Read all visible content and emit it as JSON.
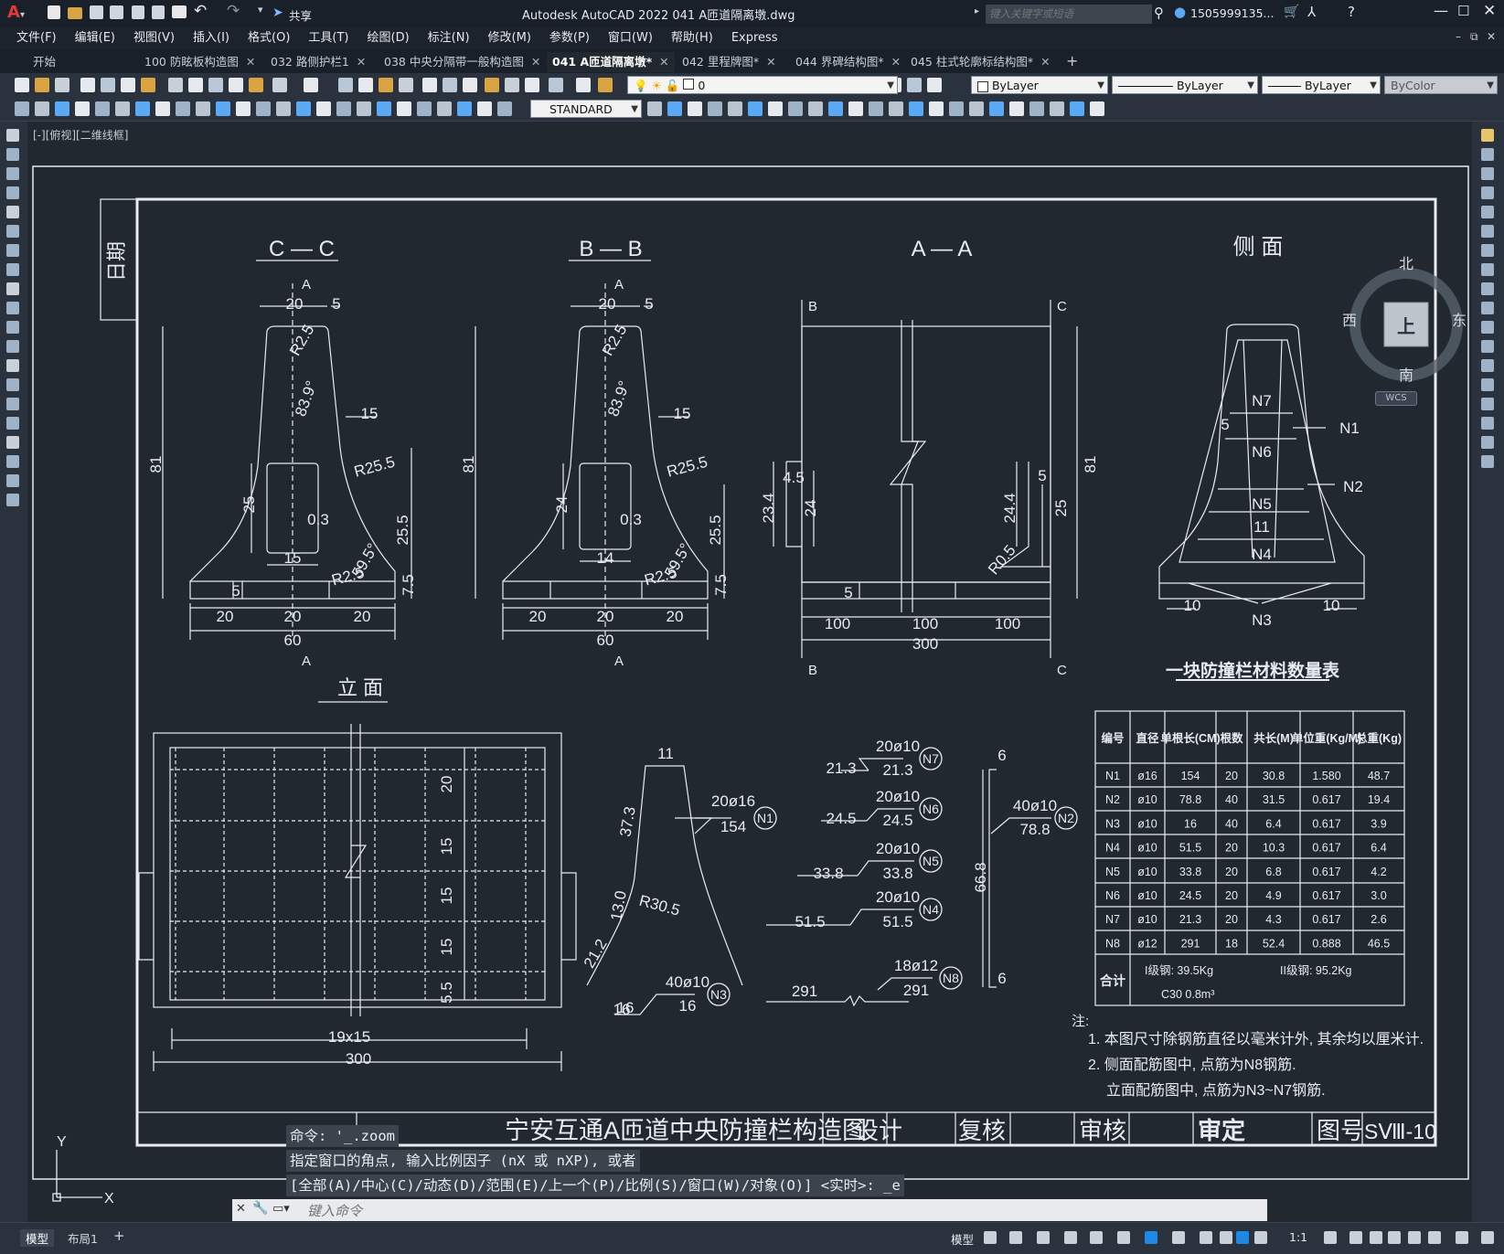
{
  "app": {
    "title": "Autodesk AutoCAD 2022    041 A匝道隔离墩.dwg",
    "share": "共享",
    "search_placeholder": "键入关键字或短语",
    "user": "1505999135...",
    "quick_access": [
      "new-icon",
      "open-icon",
      "save-icon",
      "saveas-icon",
      "plot-icon",
      "undo-icon",
      "redo-icon"
    ]
  },
  "menu": [
    "文件(F)",
    "编辑(E)",
    "视图(V)",
    "插入(I)",
    "格式(O)",
    "工具(T)",
    "绘图(D)",
    "标注(N)",
    "修改(M)",
    "参数(P)",
    "窗口(W)",
    "帮助(H)",
    "Express"
  ],
  "tabs": [
    {
      "label": "开始",
      "active": false,
      "closable": false
    },
    {
      "label": "100 防眩板构造图",
      "active": false,
      "closable": true
    },
    {
      "label": "032 路侧护栏1",
      "active": false,
      "closable": true
    },
    {
      "label": "038 中央分隔带一般构造图",
      "active": false,
      "closable": true
    },
    {
      "label": "041 A匝道隔离墩*",
      "active": true,
      "closable": true
    },
    {
      "label": "042 里程牌图*",
      "active": false,
      "closable": true
    },
    {
      "label": "044 界碑结构图*",
      "active": false,
      "closable": true
    },
    {
      "label": "045 柱式轮廓标结构图*",
      "active": false,
      "closable": true
    }
  ],
  "toolbar": {
    "layer_value": "0",
    "color": "ByLayer",
    "linetype": "ByLayer",
    "lineweight": "ByLayer",
    "plotstyle": "ByColor",
    "textstyle": "STANDARD"
  },
  "viewport_label": "[-][俯视][二维线框]",
  "viewcube": {
    "north": "北",
    "south": "南",
    "east": "东",
    "west": "西",
    "top": "上",
    "wcs": "WCS"
  },
  "drawing": {
    "date_label": "日期",
    "views": {
      "cc": "C — C",
      "bb": "B — B",
      "aa": "A — A",
      "side": "侧 面",
      "elev": "立 面"
    },
    "section_markers": {
      "a": "A",
      "b": "B",
      "c": "C"
    },
    "cc_dims": [
      "20",
      "5",
      "R2.5",
      "83.9°",
      "15",
      "R25.5",
      "81",
      "25",
      "0.3",
      "15",
      "25.5",
      "R2.5",
      "59.5°",
      "7.5",
      "5",
      "20",
      "20",
      "20",
      "60"
    ],
    "bb_dims": [
      "20",
      "5",
      "R2.5",
      "83.9°",
      "15",
      "R25.5",
      "81",
      "24",
      "0.3",
      "14",
      "25.5",
      "R2.5",
      "59.5°",
      "7.5",
      "20",
      "20",
      "20",
      "60"
    ],
    "aa_dims": [
      "4.5",
      "23.4",
      "24",
      "5",
      "24.4",
      "25",
      "81",
      "R0.5",
      "5",
      "100",
      "100",
      "100",
      "300"
    ],
    "side_labels": [
      "N7",
      "N6",
      "N5",
      "N4",
      "N1",
      "N2",
      "N3",
      "5",
      "11",
      "10",
      "10"
    ],
    "elev_dims": [
      "20",
      "15",
      "15",
      "15",
      "5.5",
      "19x15",
      "300"
    ],
    "table": {
      "title": "一块防撞栏材料数量表",
      "headers": [
        "编号",
        "直径",
        "单根长(CM)",
        "根数",
        "共长(M)",
        "单位重(Kg/M)",
        "总重(Kg)"
      ],
      "rows": [
        [
          "N1",
          "ø16",
          "154",
          "20",
          "30.8",
          "1.580",
          "48.7"
        ],
        [
          "N2",
          "ø10",
          "78.8",
          "40",
          "31.5",
          "0.617",
          "19.4"
        ],
        [
          "N3",
          "ø10",
          "16",
          "40",
          "6.4",
          "0.617",
          "3.9"
        ],
        [
          "N4",
          "ø10",
          "51.5",
          "20",
          "10.3",
          "0.617",
          "6.4"
        ],
        [
          "N5",
          "ø10",
          "33.8",
          "20",
          "6.8",
          "0.617",
          "4.2"
        ],
        [
          "N6",
          "ø10",
          "24.5",
          "20",
          "4.9",
          "0.617",
          "3.0"
        ],
        [
          "N7",
          "ø10",
          "21.3",
          "20",
          "4.3",
          "0.617",
          "2.6"
        ],
        [
          "N8",
          "ø12",
          "291",
          "18",
          "52.4",
          "0.888",
          "46.5"
        ]
      ],
      "total_label": "合计",
      "total1": "I级钢: 39.5Kg",
      "total2": "II级钢: 95.2Kg",
      "total3": "C30    0.8m³"
    },
    "rebars": [
      {
        "id": "N1",
        "spec": "20ø16",
        "len": "154"
      },
      {
        "id": "N7",
        "spec": "20ø10",
        "len": "21.3"
      },
      {
        "id": "N6",
        "spec": "20ø10",
        "len": "24.5"
      },
      {
        "id": "N5",
        "spec": "20ø10",
        "len": "33.8"
      },
      {
        "id": "N4",
        "spec": "20ø10",
        "len": "51.5"
      },
      {
        "id": "N8",
        "spec": "18ø12",
        "len": "291"
      },
      {
        "id": "N2",
        "spec": "40ø10",
        "len": "78.8"
      },
      {
        "id": "N3",
        "spec": "40ø10",
        "len": "16"
      }
    ],
    "n1_dims": [
      "11",
      "37.3",
      "13.0",
      "R30.5",
      "21.2",
      "16"
    ],
    "n2_dims": [
      "6",
      "66.8",
      "6"
    ],
    "notes": [
      "注:",
      "1. 本图尺寸除钢筋直径以毫米计外, 其余均以厘米计.",
      "2. 侧面配筋图中, 点筋为N8钢筋.",
      "立面配筋图中, 点筋为N3~N7钢筋."
    ],
    "titleblock": {
      "title": "宁安互通A匝道中央防撞栏构造图",
      "design": "设计",
      "check": "复核",
      "review": "审核",
      "approve": "审定",
      "drawno_label": "图号",
      "drawno": "SⅧ-10"
    }
  },
  "command": {
    "history": [
      "命令: '_.zoom",
      "指定窗口的角点, 输入比例因子 (nX 或 nXP), 或者",
      "[全部(A)/中心(C)/动态(D)/范围(E)/上一个(P)/比例(S)/窗口(W)/对象(O)] <实时>: _e"
    ],
    "placeholder": "键入命令"
  },
  "status": {
    "layouts": [
      "模型",
      "布局1"
    ],
    "model": "模型",
    "scale": "1:1"
  },
  "colors": {
    "accent": "#1e88e5",
    "bg": "#212830",
    "line": "#e8ecf0"
  }
}
